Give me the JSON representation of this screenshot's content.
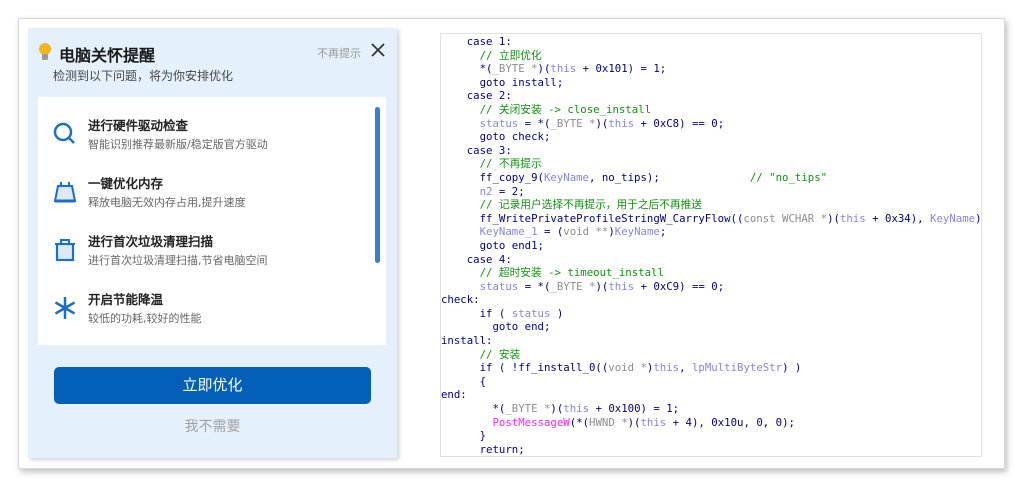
{
  "dialog": {
    "title": "电脑关怀提醒",
    "subtitle": "检测到以下问题，将为你安排优化",
    "dont_remind": "不再提示",
    "items": [
      {
        "icon": "search-icon",
        "title": "进行硬件驱动检查",
        "desc": "智能识别推荐最新版/稳定版官方驱动"
      },
      {
        "icon": "memory-icon",
        "title": "一键优化内存",
        "desc": "释放电脑无效内存占用,提升速度"
      },
      {
        "icon": "trash-icon",
        "title": "进行首次垃圾清理扫描",
        "desc": "进行首次垃圾清理扫描,节省电脑空间"
      },
      {
        "icon": "snowflake-icon",
        "title": "开启节能降温",
        "desc": "较低的功耗,较好的性能"
      }
    ],
    "primary_button": "立即优化",
    "secondary_button": "我不需要",
    "accent_color": "#035fb8"
  },
  "code": {
    "lines": [
      [
        [
          "k",
          "    case 1:"
        ]
      ],
      [
        [
          "c",
          "      // 立即优化"
        ]
      ],
      [
        [
          "k",
          "      *("
        ],
        [
          "t",
          "_BYTE *"
        ],
        [
          "k",
          ")("
        ],
        [
          "v",
          "this"
        ],
        [
          "k",
          " + 0x101) = 1;"
        ]
      ],
      [
        [
          "k",
          "      goto install;"
        ]
      ],
      [
        [
          "k",
          "    case 2:"
        ]
      ],
      [
        [
          "c",
          "      // 关闭安装 -> close_install"
        ]
      ],
      [
        [
          "v",
          "      status"
        ],
        [
          "k",
          " = *("
        ],
        [
          "t",
          "_BYTE *"
        ],
        [
          "k",
          ")("
        ],
        [
          "v",
          "this"
        ],
        [
          "k",
          " + 0xC8) == 0;"
        ]
      ],
      [
        [
          "k",
          "      goto check;"
        ]
      ],
      [
        [
          "k",
          "    case 3:"
        ]
      ],
      [
        [
          "c",
          "      // 不再提示"
        ]
      ],
      [
        [
          "k",
          "      ff_copy_9("
        ],
        [
          "v",
          "KeyName"
        ],
        [
          "k",
          ", no_tips);"
        ],
        [
          "c",
          "              // \"no_tips\""
        ]
      ],
      [
        [
          "v",
          "      n2"
        ],
        [
          "k",
          " = 2;"
        ]
      ],
      [
        [
          "c",
          "      // 记录用户选择不再提示，用于之后不再推送"
        ]
      ],
      [
        [
          "k",
          "      ff_WritePrivateProfileStringW_CarryFlow(("
        ],
        [
          "t",
          "const WCHAR *"
        ],
        [
          "k",
          ")("
        ],
        [
          "v",
          "this"
        ],
        [
          "k",
          " + 0x34), "
        ],
        [
          "v",
          "KeyName"
        ],
        [
          "k",
          ");"
        ]
      ],
      [
        [
          "v",
          "      KeyName_1"
        ],
        [
          "k",
          " = ("
        ],
        [
          "t",
          "void **"
        ],
        [
          "k",
          ")"
        ],
        [
          "v",
          "KeyName"
        ],
        [
          "k",
          ";"
        ]
      ],
      [
        [
          "k",
          "      goto end1;"
        ]
      ],
      [
        [
          "k",
          "    case 4:"
        ]
      ],
      [
        [
          "c",
          "      // 超时安装 -> timeout_install"
        ]
      ],
      [
        [
          "v",
          "      status"
        ],
        [
          "k",
          " = *("
        ],
        [
          "t",
          "_BYTE *"
        ],
        [
          "k",
          ")("
        ],
        [
          "v",
          "this"
        ],
        [
          "k",
          " + 0xC9) == 0;"
        ]
      ],
      [
        [
          "k",
          "check:"
        ]
      ],
      [
        [
          "k",
          "      if ( "
        ],
        [
          "v",
          "status"
        ],
        [
          "k",
          " )"
        ]
      ],
      [
        [
          "k",
          "        goto end;"
        ]
      ],
      [
        [
          "k",
          "install:"
        ]
      ],
      [
        [
          "c",
          "      // 安装"
        ]
      ],
      [
        [
          "k",
          "      if ( !ff_install_0(("
        ],
        [
          "t",
          "void *"
        ],
        [
          "k",
          ")"
        ],
        [
          "v",
          "this"
        ],
        [
          "k",
          ", "
        ],
        [
          "v",
          "lpMultiByteStr"
        ],
        [
          "k",
          ") )"
        ]
      ],
      [
        [
          "k",
          "      {"
        ]
      ],
      [
        [
          "k",
          "end:"
        ]
      ],
      [
        [
          "k",
          "        *("
        ],
        [
          "t",
          "_BYTE *"
        ],
        [
          "k",
          ")("
        ],
        [
          "v",
          "this"
        ],
        [
          "k",
          " + 0x100) = 1;"
        ]
      ],
      [
        [
          "p",
          "        PostMessageW"
        ],
        [
          "k",
          "(*("
        ],
        [
          "t",
          "HWND *"
        ],
        [
          "k",
          ")("
        ],
        [
          "v",
          "this"
        ],
        [
          "k",
          " + 4), 0x10u, 0, 0);"
        ]
      ],
      [
        [
          "k",
          "      }"
        ]
      ],
      [
        [
          "k",
          "      return;"
        ]
      ]
    ]
  }
}
